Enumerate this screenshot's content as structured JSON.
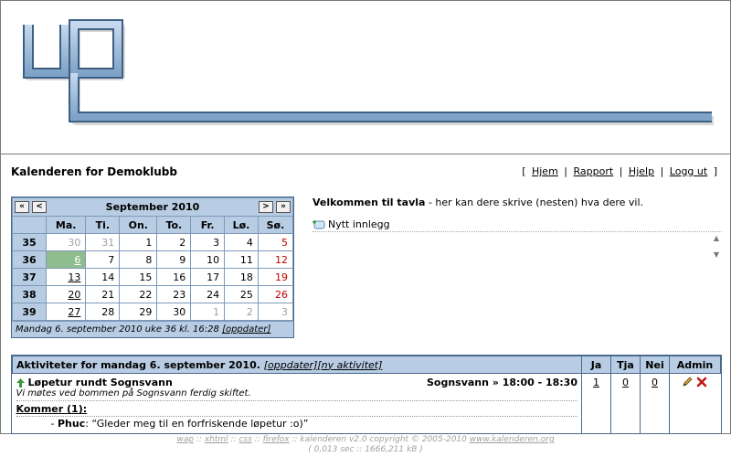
{
  "app": {
    "title": "Kalenderen for Demoklubb"
  },
  "toplinks": [
    {
      "label": "Hjem"
    },
    {
      "label": "Rapport"
    },
    {
      "label": "Hjelp"
    },
    {
      "label": "Logg ut"
    }
  ],
  "calendar": {
    "month_label": "September 2010",
    "nav": {
      "prev_year": "«",
      "prev_month": "<",
      "next_month": ">",
      "next_year": "»"
    },
    "weekdays": [
      "Ma.",
      "Ti.",
      "On.",
      "To.",
      "Fr.",
      "Lø.",
      "Sø."
    ],
    "weeks": [
      {
        "week": "35",
        "days": [
          "30",
          "31",
          "1",
          "2",
          "3",
          "4",
          "5"
        ]
      },
      {
        "week": "36",
        "days": [
          "6",
          "7",
          "8",
          "9",
          "10",
          "11",
          "12"
        ]
      },
      {
        "week": "37",
        "days": [
          "13",
          "14",
          "15",
          "16",
          "17",
          "18",
          "19"
        ]
      },
      {
        "week": "38",
        "days": [
          "20",
          "21",
          "22",
          "23",
          "24",
          "25",
          "26"
        ]
      },
      {
        "week": "39",
        "days": [
          "27",
          "28",
          "29",
          "30",
          "1",
          "2",
          "3"
        ]
      }
    ],
    "footer_text": "Mandag 6. september 2010 uke 36 kl. 16:28",
    "footer_link": "[oppdater]"
  },
  "welcome": {
    "bold": "Velkommen til tavla",
    "rest": " - her kan dere skrive (nesten) hva dere vil.",
    "new_post_label": "Nytt innlegg"
  },
  "activities": {
    "header_text": "Aktiviteter for mandag 6. september 2010.",
    "header_link_update": "[oppdater]",
    "header_link_new": "[ny aktivitet]",
    "col_yes": "Ja",
    "col_maybe": "Tja",
    "col_no": "Nei",
    "col_admin": "Admin",
    "event": {
      "name": "Løpetur rundt Sognsvann",
      "place_time": "Sognsvann » 18:00 - 18:30",
      "description": "Vi møtes ved bommen på Sognsvann ferdig skiftet.",
      "coming_label": "Kommer (1):",
      "comment_prefix": "- ",
      "comment_user": "Phuc",
      "comment_text": ": “Gleder meg til en forfriskende løpetur :o)”",
      "yes": "1",
      "maybe": "0",
      "no": "0"
    }
  },
  "footer": {
    "line1_links": [
      "wap",
      "xhtml",
      "css",
      "firefox"
    ],
    "line1_text": " :: kalenderen v2.0 copyright © 2005-2010 ",
    "line1_site": "www.kalenderen.org",
    "line2": "( 0,013 sec :: 1666,211 kB )"
  },
  "colors": {
    "accent": "#b8cde4",
    "border": "#4a6a8a",
    "today": "#8fbd8f",
    "sunday": "#c00000"
  }
}
